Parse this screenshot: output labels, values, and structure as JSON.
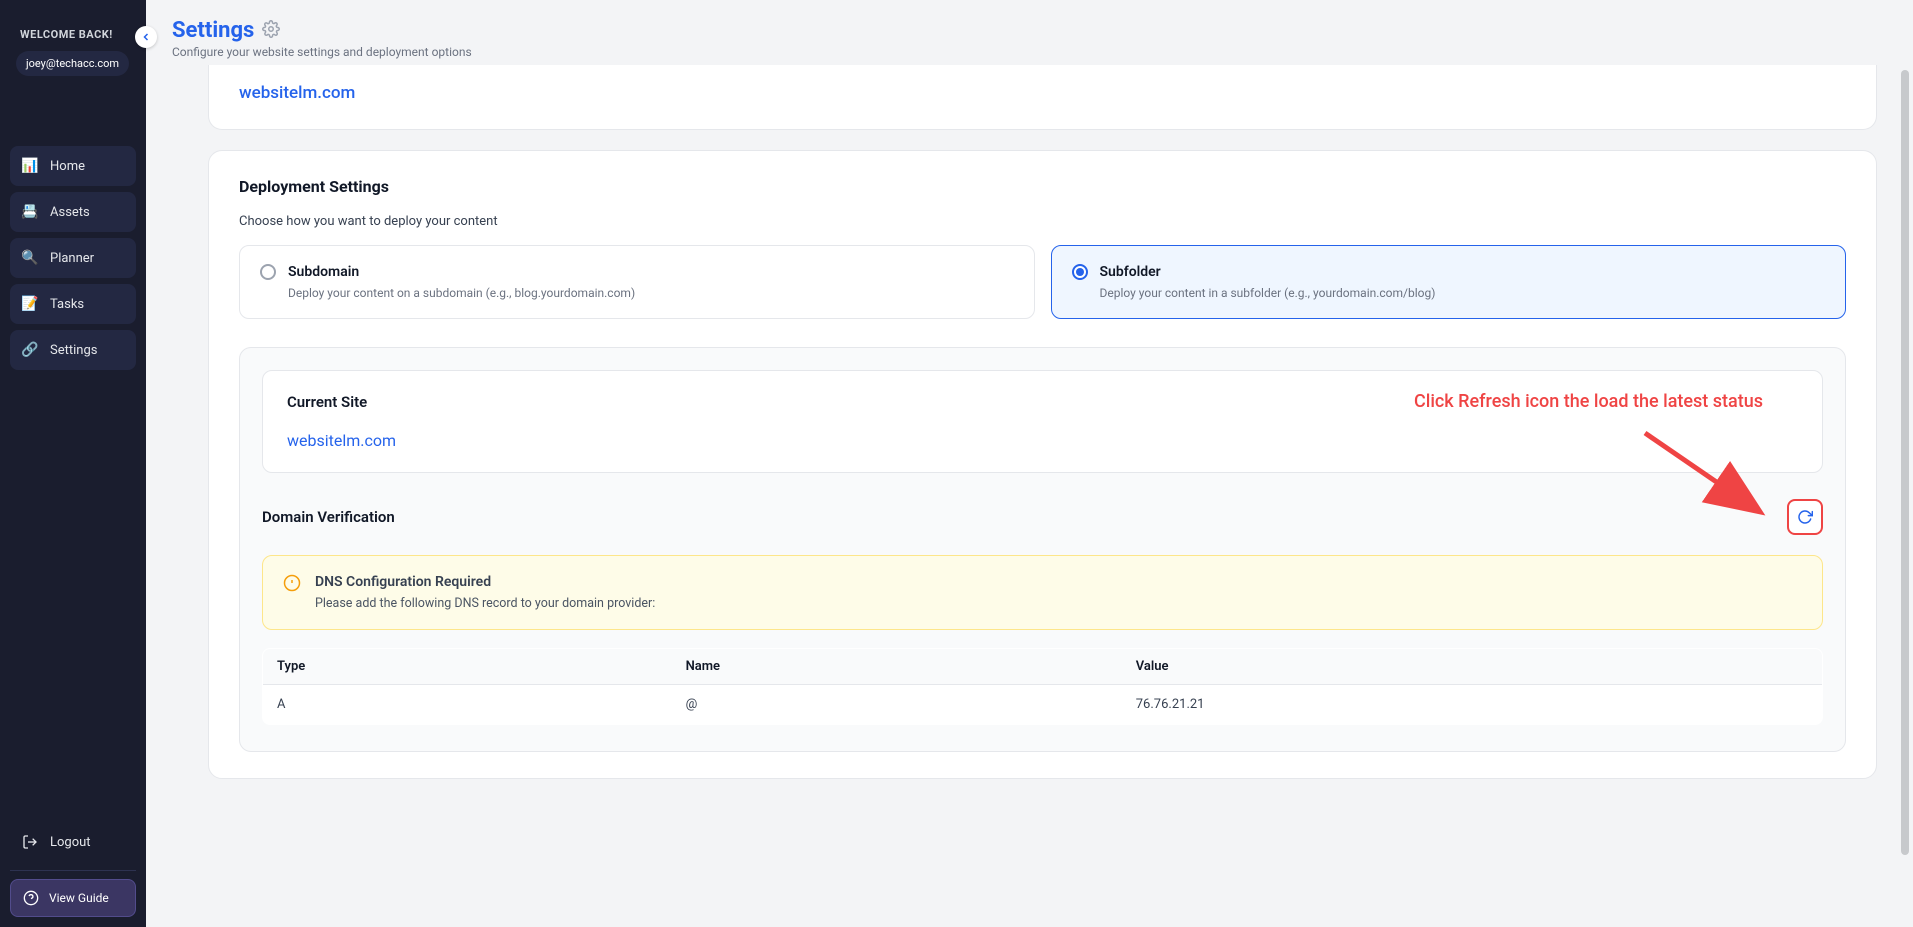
{
  "sidebar": {
    "welcome": "WELCOME BACK!",
    "email": "joey@techacc.com",
    "items": [
      {
        "icon": "📊",
        "label": "Home"
      },
      {
        "icon": "📇",
        "label": "Assets"
      },
      {
        "icon": "🔍",
        "label": "Planner"
      },
      {
        "icon": "📝",
        "label": "Tasks"
      },
      {
        "icon": "🔗",
        "label": "Settings"
      }
    ],
    "logout": "Logout",
    "guide": "View Guide"
  },
  "header": {
    "title": "Settings",
    "subtitle": "Configure your website settings and deployment options"
  },
  "top_site": "websitelm.com",
  "deployment": {
    "title": "Deployment Settings",
    "subtitle": "Choose how you want to deploy your content",
    "subdomain_label": "Subdomain",
    "subdomain_desc": "Deploy your content on a subdomain (e.g., blog.yourdomain.com)",
    "subfolder_label": "Subfolder",
    "subfolder_desc": "Deploy your content in a subfolder (e.g., yourdomain.com/blog)"
  },
  "current_site": {
    "label": "Current Site",
    "value": "websitelm.com"
  },
  "domain_verification": {
    "title": "Domain Verification",
    "annotation": "Click Refresh icon the load the latest status",
    "alert_title": "DNS Configuration Required",
    "alert_desc": "Please add the following DNS record to your domain provider:",
    "columns": {
      "type": "Type",
      "name": "Name",
      "value": "Value"
    },
    "rows": [
      {
        "type": "A",
        "name": "@",
        "value": "76.76.21.21"
      }
    ]
  }
}
